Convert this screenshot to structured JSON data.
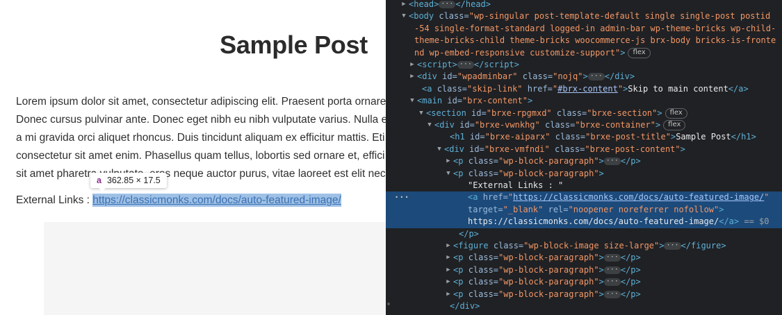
{
  "page": {
    "title": "Sample Post",
    "paragraph_lines": [
      "Lorem ipsum dolor sit amet, consectetur adipiscing elit. Praesent porta ornare",
      "Donec cursus pulvinar ante. Donec eget nibh eu nibh vulputate varius. Nulla eu",
      "a mi gravida orci aliquet rhoncus. Duis tincidunt aliquam ex efficitur mattis. Eti",
      "consectetur sit amet enim. Phasellus quam tellus, lobortis sed ornare et, effici",
      "sit amet pharetra vulputate, eros neque auctor purus, vitae laoreet est elit nec"
    ],
    "external_label": "External Links : ",
    "external_link": "https://classicmonks.com/docs/auto-featured-image/"
  },
  "tooltip": {
    "tag": "a",
    "size": "362.85 × 17.5"
  },
  "devtools": {
    "badge_flex": "flex",
    "selected_suffix": "== $0",
    "selected_dots": "···",
    "ellipsis": "···"
  }
}
